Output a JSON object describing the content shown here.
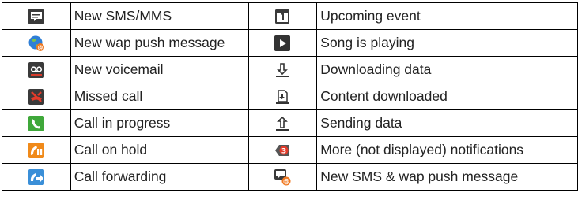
{
  "rows": [
    {
      "left": {
        "icon": "sms-mms-icon",
        "label": "New SMS/MMS"
      },
      "right": {
        "icon": "calendar-event-icon",
        "label": "Upcoming event"
      }
    },
    {
      "left": {
        "icon": "wap-push-globe-icon",
        "label": "New wap push message"
      },
      "right": {
        "icon": "play-song-icon",
        "label": "Song is playing"
      }
    },
    {
      "left": {
        "icon": "voicemail-icon",
        "label": "New voicemail"
      },
      "right": {
        "icon": "download-arrow-icon",
        "label": "Downloading data"
      }
    },
    {
      "left": {
        "icon": "missed-call-icon",
        "label": "Missed call"
      },
      "right": {
        "icon": "content-downloaded-icon",
        "label": "Content downloaded"
      }
    },
    {
      "left": {
        "icon": "call-in-progress-icon",
        "label": "Call in progress"
      },
      "right": {
        "icon": "upload-arrow-icon",
        "label": "Sending data"
      }
    },
    {
      "left": {
        "icon": "call-on-hold-icon",
        "label": "Call on hold"
      },
      "right": {
        "icon": "more-notifications-icon",
        "label": "More (not displayed) notifications"
      }
    },
    {
      "left": {
        "icon": "call-forwarding-icon",
        "label": "Call forwarding"
      },
      "right": {
        "icon": "sms-wap-push-icon",
        "label": "New SMS & wap push message"
      }
    }
  ]
}
